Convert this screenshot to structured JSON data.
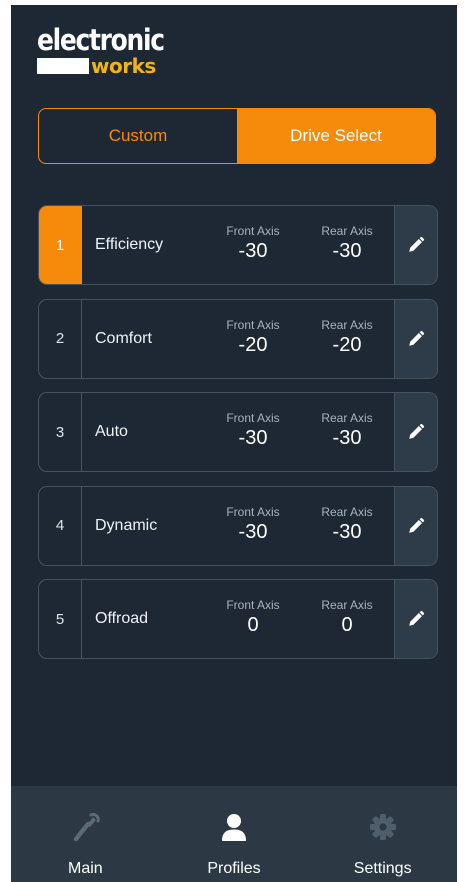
{
  "brand": {
    "line1": "electronic",
    "line2": "works"
  },
  "segmented": {
    "custom_label": "Custom",
    "drive_select_label": "Drive Select",
    "active": "Drive Select"
  },
  "profiles": [
    {
      "number": "1",
      "name": "Efficiency",
      "front_label": "Front Axis",
      "front_value": "-30",
      "rear_label": "Rear Axis",
      "rear_value": "-30",
      "selected": true
    },
    {
      "number": "2",
      "name": "Comfort",
      "front_label": "Front Axis",
      "front_value": "-20",
      "rear_label": "Rear Axis",
      "rear_value": "-20",
      "selected": false
    },
    {
      "number": "3",
      "name": "Auto",
      "front_label": "Front Axis",
      "front_value": "-30",
      "rear_label": "Rear Axis",
      "rear_value": "-30",
      "selected": false
    },
    {
      "number": "4",
      "name": "Dynamic",
      "front_label": "Front Axis",
      "front_value": "-30",
      "rear_label": "Rear Axis",
      "rear_value": "-30",
      "selected": false
    },
    {
      "number": "5",
      "name": "Offroad",
      "front_label": "Front Axis",
      "front_value": "0",
      "rear_label": "Rear Axis",
      "rear_value": "0",
      "selected": false
    }
  ],
  "nav": [
    {
      "label": "Main",
      "icon": "wrench-icon",
      "active": false
    },
    {
      "label": "Profiles",
      "icon": "user-icon",
      "active": true
    },
    {
      "label": "Settings",
      "icon": "gear-icon",
      "active": false
    }
  ],
  "colors": {
    "background": "#1d2834",
    "accent": "#f68a0a",
    "card_border": "#44535f",
    "navbar": "#2c3945",
    "brand_yellow": "#f2b21b"
  }
}
